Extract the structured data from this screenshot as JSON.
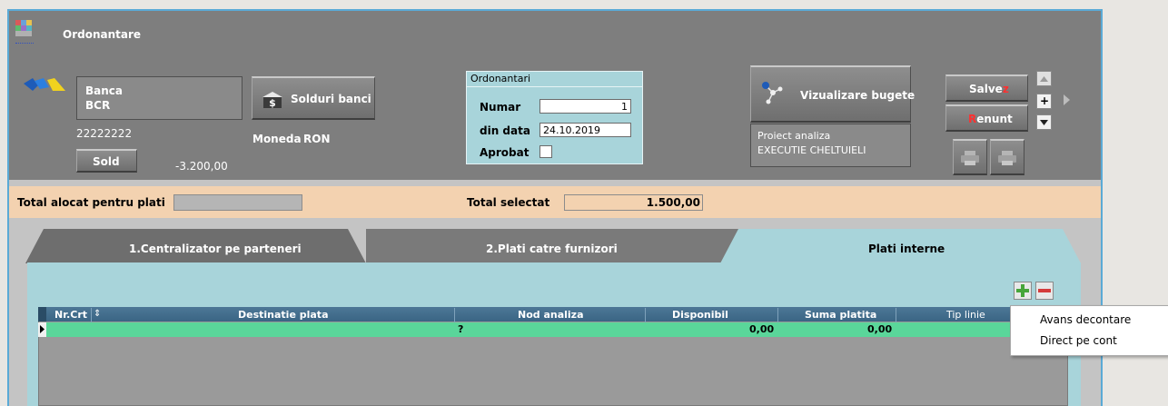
{
  "window": {
    "title": "Ordonantare"
  },
  "bank": {
    "label": "Banca",
    "name": "BCR",
    "account": "22222222",
    "sold_button": "Sold",
    "sold_value": "-3.200,00",
    "solduri_button": "Solduri banci",
    "moneda_label": "Moneda",
    "moneda_value": "RON"
  },
  "ordonantari": {
    "group_title": "Ordonantari",
    "numar_label": "Numar",
    "numar_value": "1",
    "data_label": "din data",
    "data_value": "24.10.2019",
    "aprobat_label": "Aprobat"
  },
  "bugete": {
    "button": "Vizualizare bugete",
    "proiect_label": "Proiect analiza",
    "proiect_value": "EXECUTIE CHELTUIELI"
  },
  "actions": {
    "save_prefix": "Salve",
    "save_accent": "z",
    "cancel_accent": "R",
    "cancel_rest": "enunt",
    "plus": "+"
  },
  "totals": {
    "alocat_label": "Total alocat pentru plati",
    "alocat_value": "",
    "selectat_label": "Total selectat",
    "selectat_value": "1.500,00"
  },
  "tabs": [
    {
      "label": "1.Centralizator pe parteneri"
    },
    {
      "label": "2.Plati catre furnizori"
    },
    {
      "label": "Plati interne"
    }
  ],
  "grid": {
    "columns": [
      "Nr.Crt",
      "Destinatie plata",
      "Nod analiza",
      "Disponibil",
      "Suma platita",
      "Tip linie"
    ],
    "row": {
      "nr": "",
      "destinatie": "",
      "nod": "?",
      "disponibil": "0,00",
      "suma": "0,00",
      "tip": ""
    }
  },
  "context_menu": {
    "items": [
      "Avans decontare",
      "Direct pe cont"
    ]
  },
  "colors": {
    "accent_red": "#e02020",
    "totals_bar": "#f3d2b0",
    "tab_panel": "#a8d4da",
    "grid_row": "#5ad69a",
    "grid_header": "#3f6c8c",
    "window_border": "#5aaad6"
  }
}
